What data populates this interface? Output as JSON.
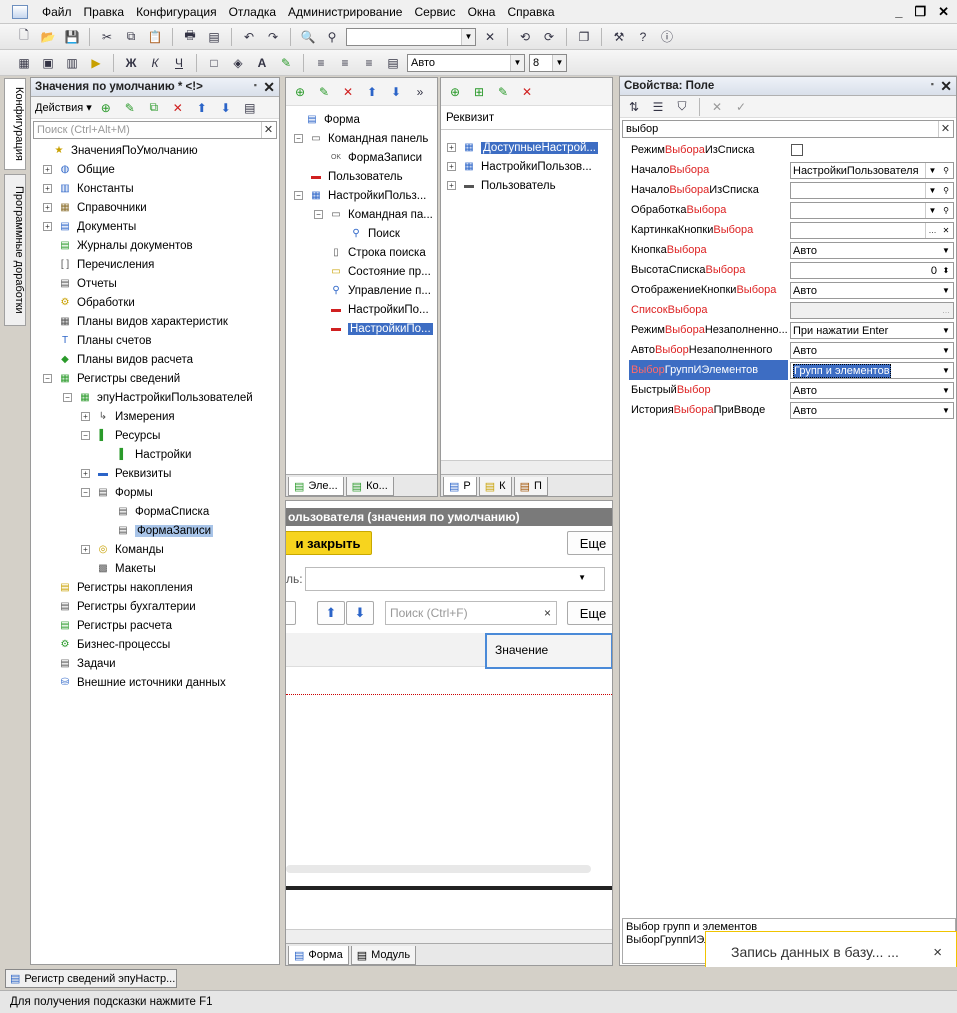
{
  "menu": [
    "Файл",
    "Правка",
    "Конфигурация",
    "Отладка",
    "Администрирование",
    "Сервис",
    "Окна",
    "Справка"
  ],
  "toolbar2": {
    "font_value": "Авто",
    "size_value": "8"
  },
  "sidebar_tabs": [
    "Конфигурация",
    "Программные доработки"
  ],
  "left_panel": {
    "title": "Значения по умолчанию * <!>",
    "actions_label": "Действия",
    "search_placeholder": "Поиск (Ctrl+Alt+M)",
    "tree": [
      {
        "label": "ЗначенияПоУмолчанию",
        "icon": "config-icon"
      },
      {
        "label": "Общие",
        "icon": "common-icon"
      },
      {
        "label": "Константы",
        "icon": "constants-icon"
      },
      {
        "label": "Справочники",
        "icon": "catalogs-icon"
      },
      {
        "label": "Документы",
        "icon": "documents-icon"
      },
      {
        "label": "Журналы документов",
        "icon": "journals-icon"
      },
      {
        "label": "Перечисления",
        "icon": "enums-icon"
      },
      {
        "label": "Отчеты",
        "icon": "reports-icon"
      },
      {
        "label": "Обработки",
        "icon": "dataprocessors-icon"
      },
      {
        "label": "Планы видов характеристик",
        "icon": "chartofcharacteristics-icon"
      },
      {
        "label": "Планы счетов",
        "icon": "chartofaccounts-icon"
      },
      {
        "label": "Планы видов расчета",
        "icon": "chartofcalc-icon"
      },
      {
        "label": "Регистры сведений",
        "icon": "inforegisters-icon"
      },
      {
        "label": "эпуНастройкиПользователей",
        "icon": "register-icon"
      },
      {
        "label": "Измерения",
        "icon": "dimensions-icon"
      },
      {
        "label": "Ресурсы",
        "icon": "resources-icon"
      },
      {
        "label": "Настройки",
        "icon": "resource-icon"
      },
      {
        "label": "Реквизиты",
        "icon": "attributes-icon"
      },
      {
        "label": "Формы",
        "icon": "forms-icon"
      },
      {
        "label": "ФормаСписка",
        "icon": "form-icon"
      },
      {
        "label": "ФормаЗаписи",
        "icon": "form-icon"
      },
      {
        "label": "Команды",
        "icon": "commands-icon"
      },
      {
        "label": "Макеты",
        "icon": "templates-icon"
      },
      {
        "label": "Регистры накопления",
        "icon": "accumregisters-icon"
      },
      {
        "label": "Регистры бухгалтерии",
        "icon": "accountingregisters-icon"
      },
      {
        "label": "Регистры расчета",
        "icon": "calcregisters-icon"
      },
      {
        "label": "Бизнес-процессы",
        "icon": "businessprocesses-icon"
      },
      {
        "label": "Задачи",
        "icon": "tasks-icon"
      },
      {
        "label": "Внешние источники данных",
        "icon": "externaldatasources-icon"
      }
    ]
  },
  "elements_panel": {
    "items": [
      "Форма",
      "Командная панель",
      "ФормаЗаписи",
      "Пользователь",
      "НастройкиПольз...",
      "Командная па...",
      "Поиск",
      "Строка поиска",
      "Состояние пр...",
      "Управление п...",
      "НастройкиПо...",
      "НастройкиПо..."
    ],
    "tabs": [
      "Эле...",
      "Ко..."
    ]
  },
  "attrs_panel": {
    "header": "Реквизит",
    "items": [
      "ДоступныеНастрой...",
      "НастройкиПользов...",
      "Пользователь"
    ],
    "tabs": [
      "Р",
      "К",
      "П"
    ]
  },
  "preview": {
    "title": "ользователя (значения по умолчанию)",
    "save_close": "и закрыть",
    "more1": "Еще",
    "field_label": "ль:",
    "search_placeholder": "Поиск (Ctrl+F)",
    "more2": "Еще",
    "column": "Значение",
    "tabs": [
      "Форма",
      "Модуль"
    ]
  },
  "properties": {
    "title": "Свойства: Поле",
    "filter": "выбор",
    "rows": [
      {
        "pre": "Режим",
        "hl": "Выбора",
        "post": "ИзСписка",
        "value": "",
        "type": "checkbox"
      },
      {
        "pre": "Начало",
        "hl": "Выбора",
        "post": "",
        "value": "НастройкиПользователя",
        "type": "select-search"
      },
      {
        "pre": "Начало",
        "hl": "Выбора",
        "post": "ИзСписка",
        "value": "",
        "type": "select-search"
      },
      {
        "pre": "Обработка",
        "hl": "Выбора",
        "post": "",
        "value": "",
        "type": "select-search"
      },
      {
        "pre": "КартинкаКнопки",
        "hl": "Выбора",
        "post": "",
        "value": "",
        "type": "dots-clear"
      },
      {
        "pre": "Кнопка",
        "hl": "Выбора",
        "post": "",
        "value": "Авто",
        "type": "select"
      },
      {
        "pre": "ВысотаСписка",
        "hl": "Выбора",
        "post": "",
        "value": "0",
        "type": "number"
      },
      {
        "pre": "ОтображениеКнопки",
        "hl": "Выбора",
        "post": "",
        "value": "Авто",
        "type": "select"
      },
      {
        "pre": "Список",
        "hl": "Выбора",
        "post": "",
        "value": "",
        "type": "dots-disabled"
      },
      {
        "pre": "Режим",
        "hl": "Выбора",
        "post": "Незаполненно...",
        "value": "При нажатии Enter",
        "type": "select"
      },
      {
        "pre": "Авто",
        "hl": "Выбор",
        "post": "Незаполненного",
        "value": "Авто",
        "type": "select"
      },
      {
        "pre": "",
        "hl": "Выбор",
        "post": "ГруппИЭлементов",
        "value": "Групп и элементов",
        "type": "select-selected"
      },
      {
        "pre": "Быстрый",
        "hl": "Выбор",
        "post": "",
        "value": "Авто",
        "type": "select"
      },
      {
        "pre": "История",
        "hl": "Выбора",
        "post": "ПриВводе",
        "value": "Авто",
        "type": "select"
      }
    ],
    "description_line1": "Выбор групп и элементов",
    "description_line2": "ВыборГруппИЭл"
  },
  "notification": {
    "text": "Запись данных в базу... ..."
  },
  "taskbar": {
    "item": "Регистр сведений эпуНастр..."
  },
  "status": "Для получения подсказки нажмите F1"
}
